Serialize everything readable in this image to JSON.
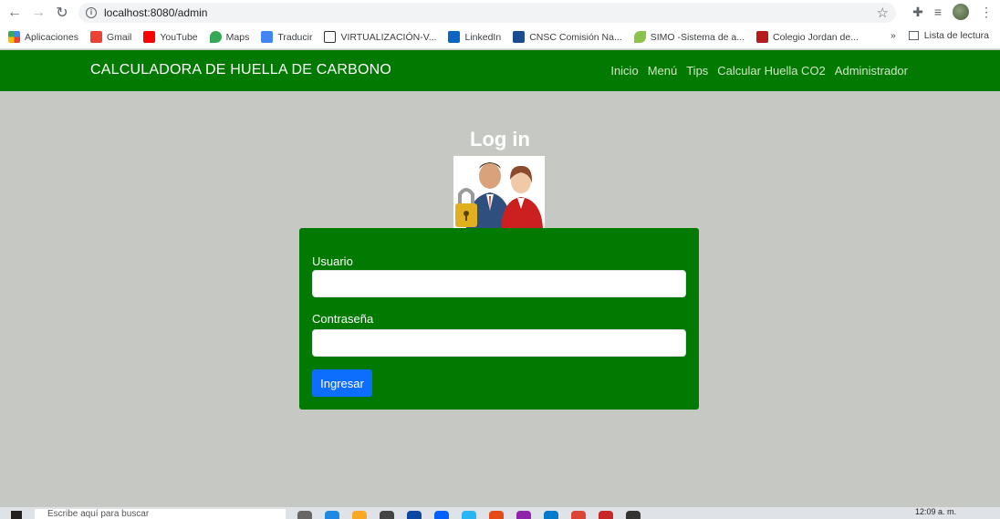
{
  "browser": {
    "url": "localhost:8080/admin",
    "bookmarks": [
      {
        "label": "Aplicaciones",
        "color": "#4285f4"
      },
      {
        "label": "Gmail",
        "color": "#ea4335"
      },
      {
        "label": "YouTube",
        "color": "#ff0000"
      },
      {
        "label": "Maps",
        "color": "#34a853"
      },
      {
        "label": "Traducir",
        "color": "#4285f4"
      },
      {
        "label": "VIRTUALIZACIÓN-V...",
        "color": "#333333"
      },
      {
        "label": "LinkedIn",
        "color": "#0a66c2"
      },
      {
        "label": "CNSC Comisión Na...",
        "color": "#1a4d8f"
      },
      {
        "label": "SIMO -Sistema de a...",
        "color": "#8bc34a"
      },
      {
        "label": "Colegio Jordan de...",
        "color": "#b71c1c"
      }
    ],
    "more_bookmarks": "»",
    "reading_list": "Lista de lectura"
  },
  "navbar": {
    "brand": "CALCULADORA DE HUELLA DE CARBONO",
    "links": [
      "Inicio",
      "Menú",
      "Tips",
      "Calcular Huella CO2",
      "Administrador"
    ],
    "color": "#027a02"
  },
  "login": {
    "title": "Log in",
    "username_label": "Usuario",
    "password_label": "Contraseña",
    "submit_label": "Ingresar",
    "submit_color": "#0d6efd"
  },
  "taskbar": {
    "search_placeholder": "Escribe aquí para buscar",
    "time": "12:09 a. m."
  }
}
